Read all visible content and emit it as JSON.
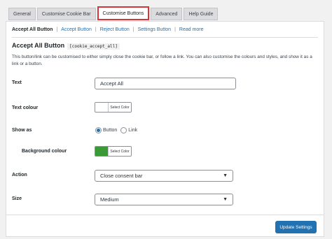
{
  "tabs": [
    "General",
    "Customise Cookie Bar",
    "Customise Buttons",
    "Advanced",
    "Help Guide"
  ],
  "subnav": [
    "Accept All Button",
    "Accept Button",
    "Reject Button",
    "Settings Button",
    "Read more"
  ],
  "section": {
    "title": "Accept All Button",
    "shortcode": "[cookie_accept_all]",
    "description": "This button/link can be customised to either simply close the cookie bar, or follow a link. You can also customise the colours and styles, and show it as a link or a button."
  },
  "form": {
    "text_label": "Text",
    "text_value": "Accept All",
    "text_colour_label": "Text colour",
    "select_color_label": "Select Color",
    "show_as_label": "Show as",
    "show_as_options": [
      "Button",
      "Link"
    ],
    "show_as_selected": "Button",
    "background_colour_label": "Background colour",
    "action_label": "Action",
    "action_value": "Close consent bar",
    "size_label": "Size",
    "size_value": "Medium"
  },
  "colors": {
    "text_colour_swatch": "#ffffff",
    "background_colour_swatch": "#3a9a35",
    "accent": "#2271b1",
    "active_tab_border": "#d63638"
  },
  "icons": {
    "dropdown": "chevron-down-icon"
  },
  "footer": {
    "update_label": "Update Settings"
  }
}
